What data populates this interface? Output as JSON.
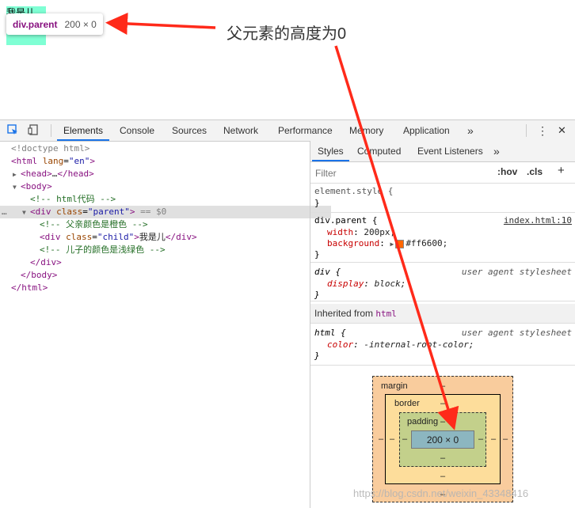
{
  "page": {
    "child_text": "我是儿",
    "tooltip": {
      "element": "div.parent",
      "size": "200 × 0"
    },
    "annotation": "父元素的高度为0",
    "watermark": "https://blog.csdn.net/weixin_43348416"
  },
  "toolbar": {
    "tabs": [
      "Elements",
      "Console",
      "Sources",
      "Network",
      "Performance",
      "Memory",
      "Application"
    ],
    "active_tab": "Elements",
    "more": "»",
    "menu": "⋮",
    "close": "✕"
  },
  "dom": {
    "doctype": "<!doctype html>",
    "html_open": {
      "tag": "html",
      "attr": "lang",
      "value": "\"en\""
    },
    "head": {
      "open": "<head>",
      "ellipsis": "…",
      "close": "</head>"
    },
    "body_open": "<body>",
    "comment1": "<!-- html代码 -->",
    "div_parent": {
      "tag": "div",
      "attr": "class",
      "value": "\"parent\"",
      "suffix": "== $0"
    },
    "comment2": "<!-- 父亲颜色是橙色 -->",
    "div_child": {
      "tag": "div",
      "attr": "class",
      "value": "\"child\"",
      "text": "我是儿",
      "close": "</div>"
    },
    "comment3": "<!-- 儿子的颜色是浅绿色 -->",
    "div_close": "</div>",
    "body_close": "</body>",
    "html_close": "</html>",
    "dots": "…"
  },
  "styles_pane": {
    "tabs": [
      "Styles",
      "Computed",
      "Event Listeners"
    ],
    "active_tab": "Styles",
    "more": "»",
    "filter_placeholder": "Filter",
    "hov": ":hov",
    "cls": ".cls",
    "plus": "+",
    "rules": [
      {
        "selector": "element.style {",
        "close": "}"
      },
      {
        "selector": "div.parent {",
        "source": "index.html:10",
        "props": [
          {
            "name": "width",
            "value": "200px;"
          },
          {
            "name": "background",
            "value": "#ff6600;",
            "swatch": "#ff6600"
          }
        ],
        "close": "}"
      },
      {
        "selector": "div {",
        "source": "user agent stylesheet",
        "props": [
          {
            "name": "display",
            "value": "block;"
          }
        ],
        "close": "}"
      }
    ],
    "inherited": {
      "label": "Inherited from",
      "tag": "html"
    },
    "inherited_rule": {
      "selector": "html {",
      "source": "user agent stylesheet",
      "props": [
        {
          "name": "color",
          "value": "-internal-root-color;"
        }
      ],
      "close": "}"
    }
  },
  "box_model": {
    "margin_label": "margin",
    "border_label": "border",
    "padding_label": "padding",
    "content": "200 × 0",
    "dash": "–"
  },
  "colors": {
    "accent": "#1a73e8",
    "arrow": "#ff2a1a",
    "parent_bg": "#ff6600",
    "child_bg": "#7fffd4"
  }
}
